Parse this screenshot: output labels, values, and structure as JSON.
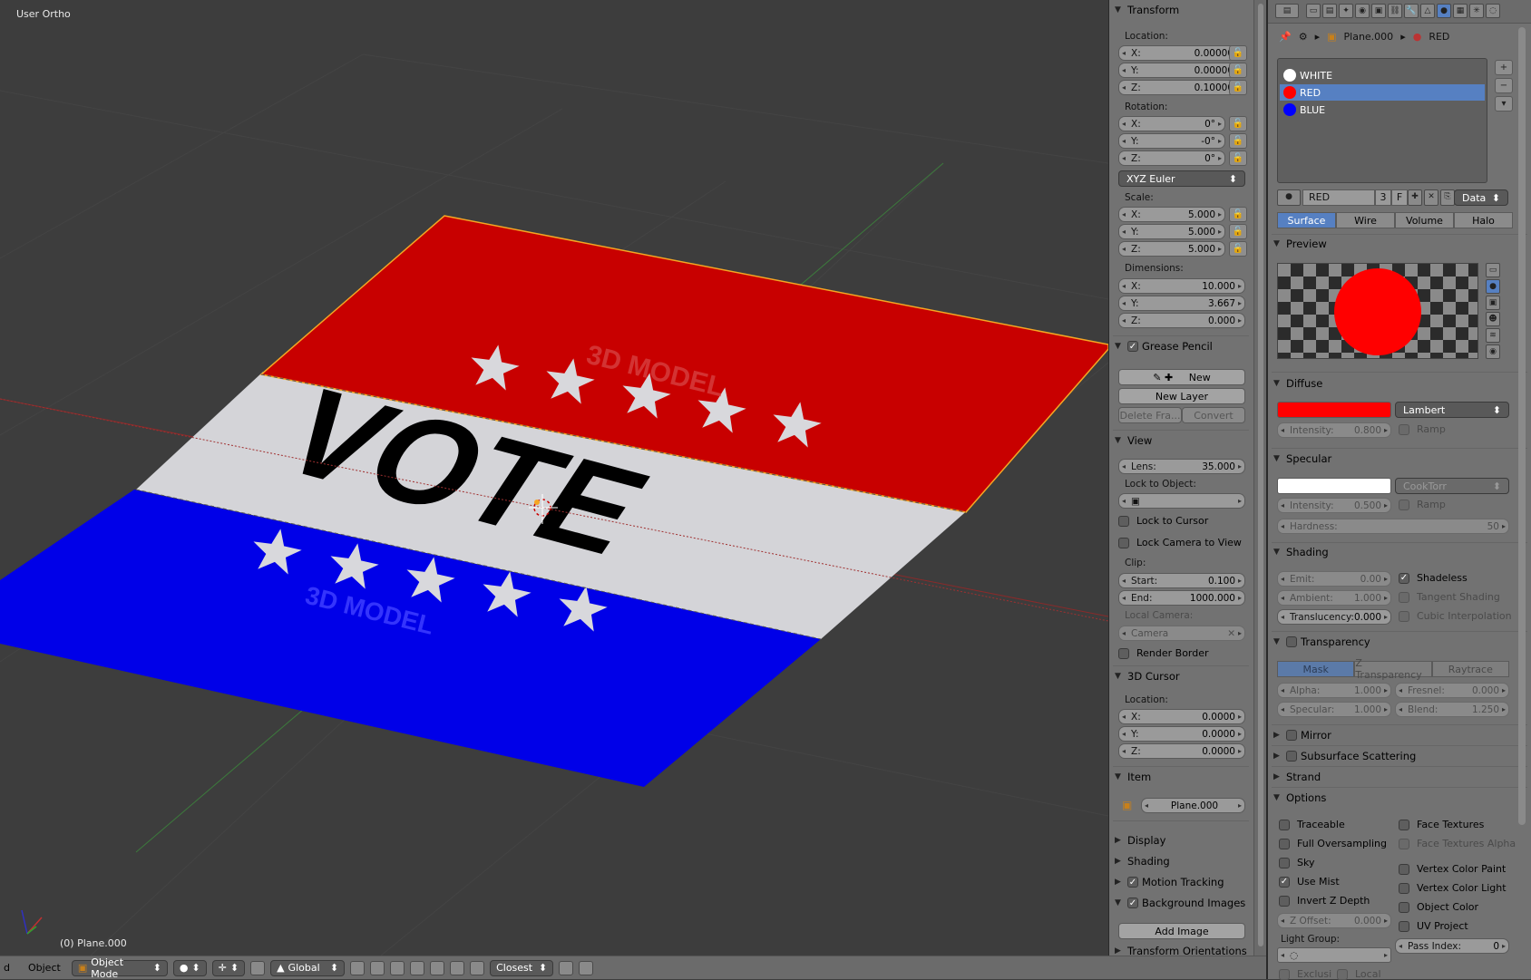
{
  "viewport": {
    "view_name": "User Ortho",
    "object_status": "(0) Plane.000",
    "vote_text": "VOTE",
    "watermark": "3D MODEL",
    "colors": {
      "red": "#c80000",
      "blue": "#0000e6",
      "white": "#d7d7db"
    }
  },
  "npanel": {
    "transform": {
      "title": "Transform",
      "location_label": "Location:",
      "location": [
        {
          "k": "X:",
          "v": "0.00000"
        },
        {
          "k": "Y:",
          "v": "0.00000"
        },
        {
          "k": "Z:",
          "v": "0.10000"
        }
      ],
      "rotation_label": "Rotation:",
      "rotation": [
        {
          "k": "X:",
          "v": "0°"
        },
        {
          "k": "Y:",
          "v": "-0°"
        },
        {
          "k": "Z:",
          "v": "0°"
        }
      ],
      "rotation_mode": "XYZ Euler",
      "scale_label": "Scale:",
      "scale": [
        {
          "k": "X:",
          "v": "5.000"
        },
        {
          "k": "Y:",
          "v": "5.000"
        },
        {
          "k": "Z:",
          "v": "5.000"
        }
      ],
      "dimensions_label": "Dimensions:",
      "dimensions": [
        {
          "k": "X:",
          "v": "10.000"
        },
        {
          "k": "Y:",
          "v": "3.667"
        },
        {
          "k": "Z:",
          "v": "0.000"
        }
      ]
    },
    "grease": {
      "title": "Grease Pencil",
      "new": "New",
      "new_layer": "New Layer",
      "delete_frame": "Delete Fra...",
      "convert": "Convert"
    },
    "view": {
      "title": "View",
      "lens_k": "Lens:",
      "lens_v": "35.000",
      "lock_obj": "Lock to Object:",
      "lock_cursor": "Lock to Cursor",
      "lock_camera": "Lock Camera to View",
      "clip": "Clip:",
      "start_k": "Start:",
      "start_v": "0.100",
      "end_k": "End:",
      "end_v": "1000.000",
      "local_camera": "Local Camera:",
      "camera": "Camera",
      "render_border": "Render Border"
    },
    "cursor": {
      "title": "3D Cursor",
      "location_label": "Location:",
      "location": [
        {
          "k": "X:",
          "v": "0.0000"
        },
        {
          "k": "Y:",
          "v": "0.0000"
        },
        {
          "k": "Z:",
          "v": "0.0000"
        }
      ]
    },
    "item": {
      "title": "Item",
      "name": "Plane.000"
    },
    "display": "Display",
    "shading": "Shading",
    "motion": "Motion Tracking",
    "bg_images": "Background Images",
    "add_image": "Add Image",
    "transform_orient": "Transform Orientations"
  },
  "props": {
    "breadcrumb_obj": "Plane.000",
    "breadcrumb_mat": "RED",
    "materials": [
      {
        "name": "WHITE",
        "color": "#ffffff"
      },
      {
        "name": "RED",
        "color": "#ff0000"
      },
      {
        "name": "BLUE",
        "color": "#0000ff"
      }
    ],
    "mat_name": "RED",
    "users": "3",
    "fake": "F",
    "link": "Data",
    "tabs": [
      "Surface",
      "Wire",
      "Volume",
      "Halo"
    ],
    "preview": "Preview",
    "diffuse": {
      "title": "Diffuse",
      "color": "#ff0000",
      "shader": "Lambert",
      "intensity_k": "Intensity:",
      "intensity_v": "0.800",
      "ramp": "Ramp"
    },
    "specular": {
      "title": "Specular",
      "color": "#ffffff",
      "shader": "CookTorr",
      "intensity_k": "Intensity:",
      "intensity_v": "0.500",
      "ramp": "Ramp",
      "hardness_k": "Hardness:",
      "hardness_v": "50"
    },
    "shading": {
      "title": "Shading",
      "emit_k": "Emit:",
      "emit_v": "0.00",
      "ambient_k": "Ambient:",
      "ambient_v": "1.000",
      "transl_k": "Translucency:",
      "transl_v": "0.000",
      "shadeless": "Shadeless",
      "tangent": "Tangent Shading",
      "cubic": "Cubic Interpolation"
    },
    "transparency": {
      "title": "Transparency",
      "modes": [
        "Mask",
        "Z Transparency",
        "Raytrace"
      ],
      "alpha_k": "Alpha:",
      "alpha_v": "1.000",
      "fresnel_k": "Fresnel:",
      "fresnel_v": "0.000",
      "specular_k": "Specular:",
      "specular_v": "1.000",
      "blend_k": "Blend:",
      "blend_v": "1.250"
    },
    "mirror": "Mirror",
    "sss": "Subsurface Scattering",
    "strand": "Strand",
    "options": {
      "title": "Options",
      "traceable": "Traceable",
      "full_over": "Full Oversampling",
      "sky": "Sky",
      "use_mist": "Use Mist",
      "invert_z": "Invert Z Depth",
      "zoffset_k": "Z Offset:",
      "zoffset_v": "0.000",
      "light_group": "Light Group:",
      "face_tex": "Face Textures",
      "face_tex_alpha": "Face Textures Alpha",
      "vcol_paint": "Vertex Color Paint",
      "vcol_light": "Vertex Color Light",
      "obj_color": "Object Color",
      "uv_project": "UV Project",
      "pass_k": "Pass Index:",
      "pass_v": "0",
      "exclusive": "Exclusi",
      "local": "Local"
    }
  },
  "bottombar": {
    "view": "d",
    "object": "Object",
    "mode": "Object Mode",
    "orientation": "Global",
    "snap": "Closest"
  }
}
